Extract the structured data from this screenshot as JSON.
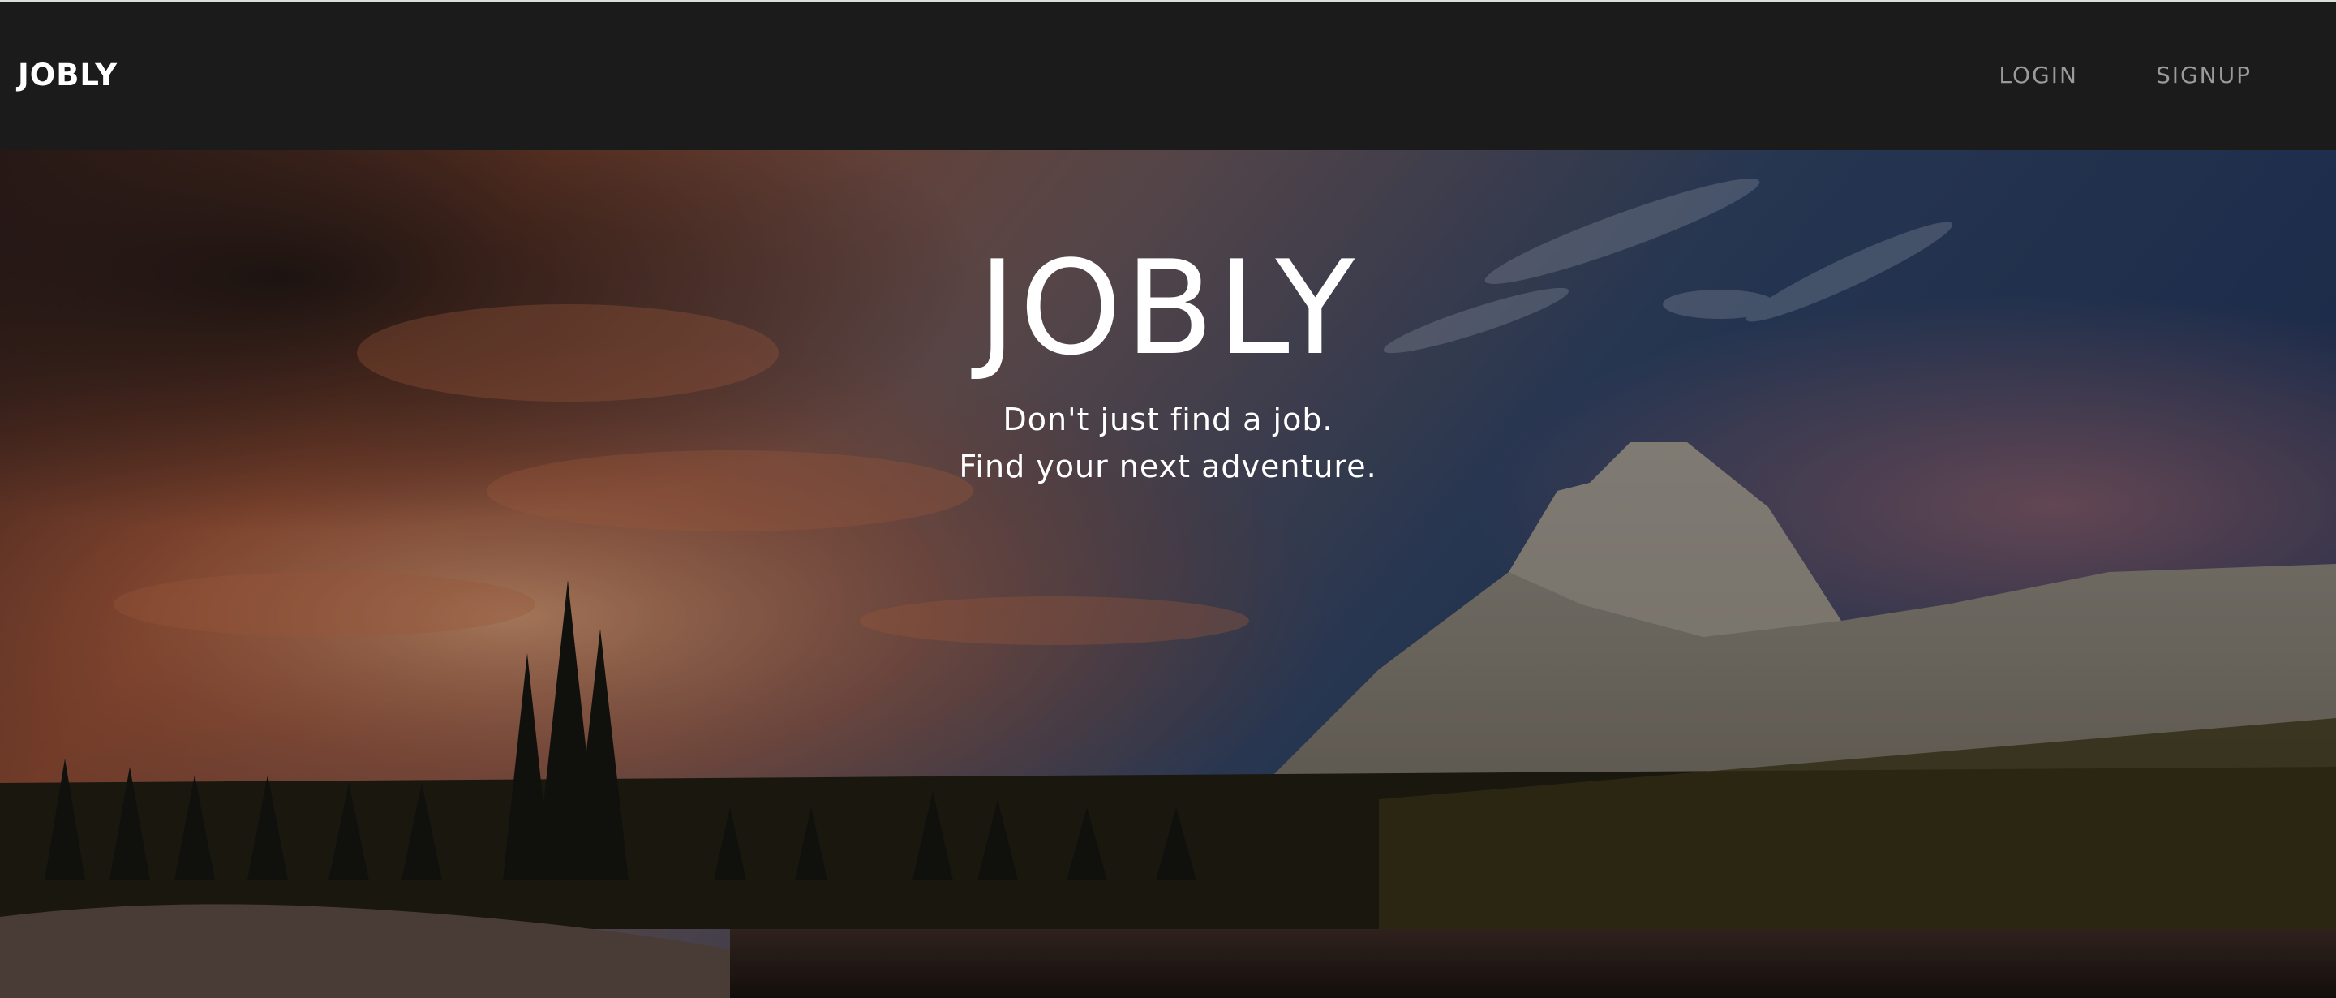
{
  "navbar": {
    "brand": "JOBLY",
    "links": [
      {
        "label": "LOGIN"
      },
      {
        "label": "SIGNUP"
      }
    ]
  },
  "hero": {
    "title": "JOBLY",
    "tagline_line1": "Don't just find a job.",
    "tagline_line2": "Find your next adventure.",
    "background": "mountain-lake-sunset-image"
  }
}
